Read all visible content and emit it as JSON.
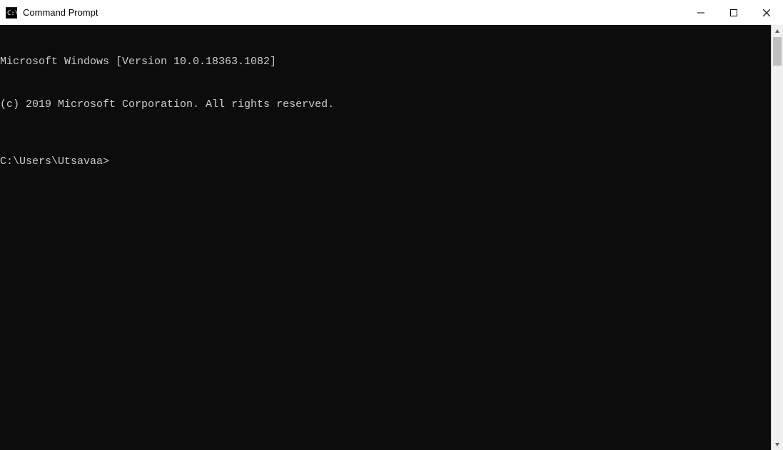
{
  "window": {
    "title": "Command Prompt"
  },
  "terminal": {
    "line1": "Microsoft Windows [Version 10.0.18363.1082]",
    "line2": "(c) 2019 Microsoft Corporation. All rights reserved.",
    "prompt": "C:\\Users\\Utsavaa>"
  }
}
